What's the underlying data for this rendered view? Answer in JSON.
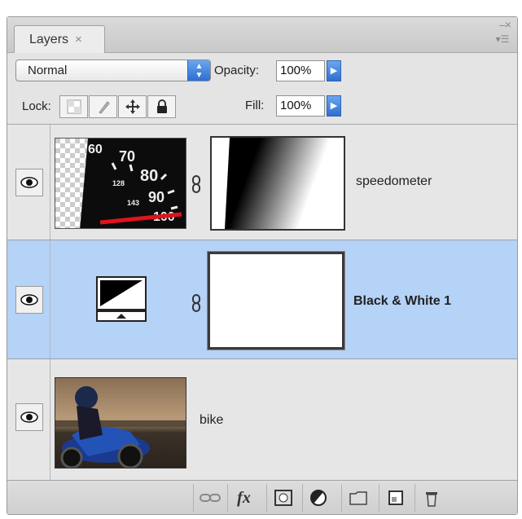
{
  "panel": {
    "tab_label": "Layers",
    "tab_close": "×",
    "window_controls": [
      "–",
      "×",
      "▾☰"
    ]
  },
  "blend": {
    "mode": "Normal",
    "opacity_label": "Opacity:",
    "opacity_value": "100%"
  },
  "lock": {
    "label": "Lock:",
    "fill_label": "Fill:",
    "fill_value": "100%"
  },
  "layers": [
    {
      "name": "speedometer",
      "selected": false,
      "visible": true,
      "thumb": "speedometer-photo",
      "mask": "gradient-mask",
      "speedo_numbers": [
        "60",
        "70",
        "80",
        "90",
        "100",
        "128",
        "143"
      ]
    },
    {
      "name": "Black & White 1",
      "selected": true,
      "visible": true,
      "thumb": "adjustment-icon",
      "mask": "white-mask"
    },
    {
      "name": "bike",
      "selected": false,
      "visible": true,
      "thumb": "bike-photo"
    }
  ],
  "colors": {
    "selected_row": "#b5d2f7",
    "panel_bg": "#e4e4e4",
    "accent": "#2c6fd2"
  },
  "bottom_icons": [
    "link-layers-icon",
    "fx-icon",
    "mask-icon",
    "adjustment-layer-icon",
    "folder-icon",
    "new-layer-icon",
    "trash-icon"
  ],
  "fx_label": "fx"
}
